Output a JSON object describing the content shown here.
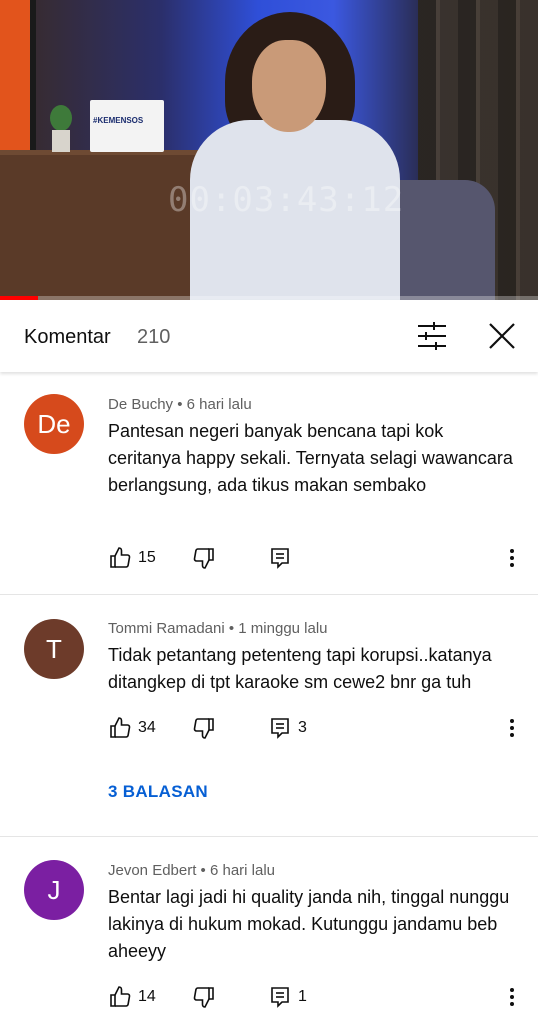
{
  "video": {
    "sign_text": "#KEMENSOS",
    "watermark": "00:03:43:12",
    "progress_fraction": 0.07
  },
  "header": {
    "title": "Komentar",
    "count": "210"
  },
  "comments": [
    {
      "avatar_text": "De",
      "avatar_color": "#d64a1c",
      "meta": "De Buchy • 6 hari lalu",
      "text": "Pantesan negeri banyak bencana tapi kok ceritanya happy sekali. Ternyata selagi wawancara berlangsung, ada tikus makan sembako",
      "likes": "15",
      "replies_count": ""
    },
    {
      "avatar_text": "T",
      "avatar_color": "#6d3b2a",
      "meta": "Tommi Ramadani • 1 minggu lalu",
      "text": "Tidak petantang petenteng tapi korupsi..katanya ditangkep di tpt karaoke sm cewe2 bnr ga tuh",
      "likes": "34",
      "replies_count": "3",
      "replies_label": "3 BALASAN"
    },
    {
      "avatar_text": "J",
      "avatar_color": "#7b1fa2",
      "meta": "Jevon Edbert • 6 hari lalu",
      "text": "Bentar lagi jadi hi quality janda nih, tinggal nunggu lakinya di hukum mokad. Kutunggu jandamu beb aheeyy",
      "likes": "14",
      "replies_count": "1"
    }
  ]
}
